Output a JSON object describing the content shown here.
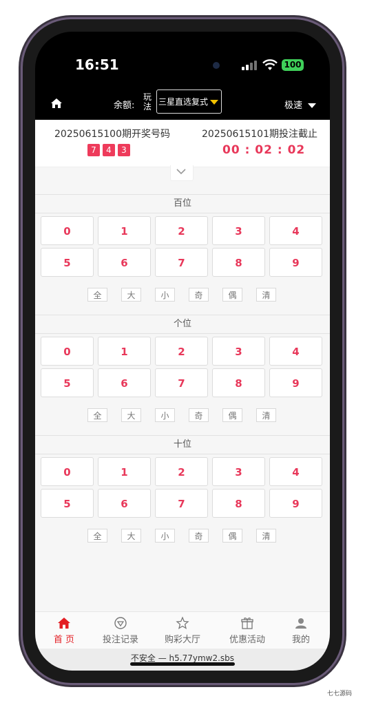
{
  "status_bar": {
    "time": "16:51",
    "battery": "100"
  },
  "header": {
    "balance_label": "余额:",
    "play_label": "玩法",
    "play_mode": "三星直选复式",
    "speed_label": "极速"
  },
  "draw": {
    "last_issue": "20250615100期开奖号码",
    "balls": [
      "7",
      "4",
      "3"
    ],
    "next_issue": "20250615101期投注截止",
    "countdown": "00 : 02 : 02"
  },
  "sections": [
    {
      "title": "百位"
    },
    {
      "title": "个位"
    },
    {
      "title": "十位"
    }
  ],
  "digits": [
    "0",
    "1",
    "2",
    "3",
    "4",
    "5",
    "6",
    "7",
    "8",
    "9"
  ],
  "quick_buttons": [
    "全",
    "大",
    "小",
    "奇",
    "偶",
    "清"
  ],
  "nav": [
    {
      "label": "首 页"
    },
    {
      "label": "投注记录"
    },
    {
      "label": "购彩大厅"
    },
    {
      "label": "优惠活动"
    },
    {
      "label": "我的"
    }
  ],
  "browser": {
    "url_text": "不安全 — h5.77ymw2.sbs"
  },
  "watermark": "七七源码",
  "colors": {
    "accent": "#e8385a",
    "nav_active": "#e31e24",
    "caret": "#f2c200",
    "battery": "#3fd05a"
  }
}
